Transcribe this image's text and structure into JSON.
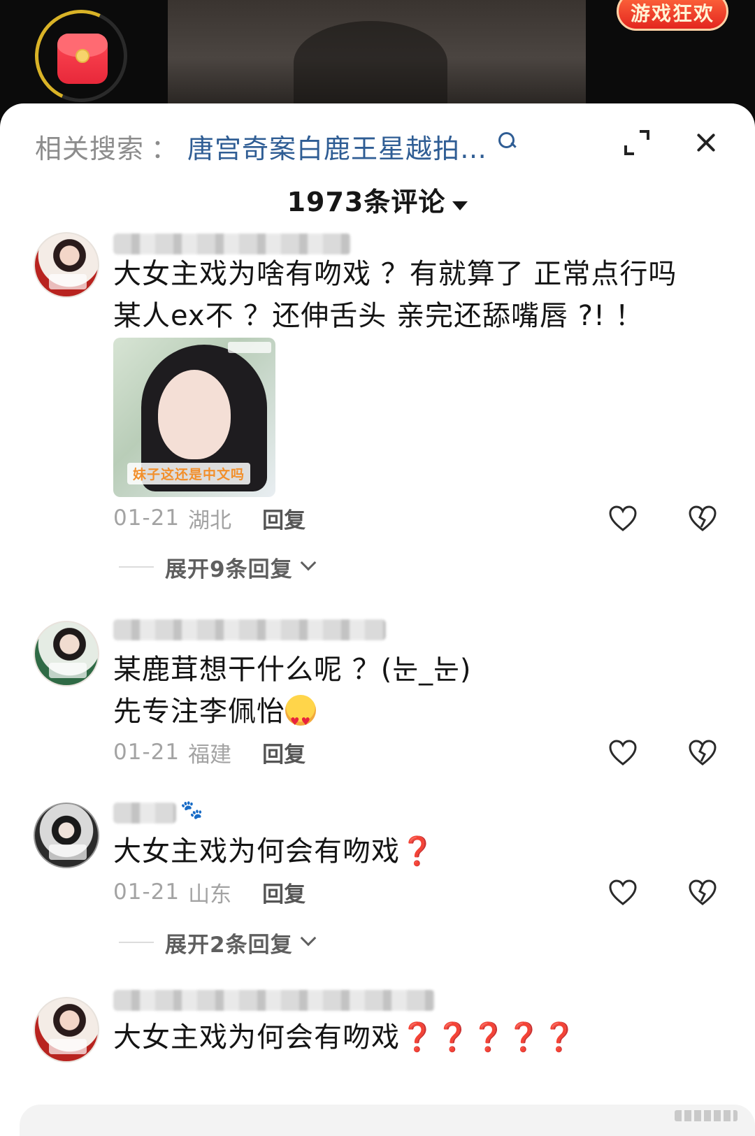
{
  "top": {
    "game_badge": "游戏狂欢",
    "red_packet_icon": "red-envelope-icon"
  },
  "header": {
    "search_label": "相关搜索",
    "search_colon": "：",
    "search_term": "唐宫奇案白鹿王星越拍…",
    "icons": [
      "search-icon",
      "expand-icon",
      "close-icon"
    ]
  },
  "comment_count": "1973条评论",
  "comments": [
    {
      "lines": [
        "大女主戏为啥有吻戏 ？有就算了 正常点行吗",
        "某人ex不 ？还伸舌头 亲完还舔嘴唇 ?! ！"
      ],
      "image_caption": "妹子这还是中文吗",
      "date": "01-21",
      "location": "湖北",
      "reply": "回复",
      "expand": "展开9条回复"
    },
    {
      "lines": [
        "某鹿茸想干什么呢 ？(눈_눈)",
        "先专注李佩怡"
      ],
      "date": "01-21",
      "location": "福建",
      "reply": "回复"
    },
    {
      "text": "大女主戏为何会有吻戏",
      "suffix": "❓",
      "date": "01-21",
      "location": "山东",
      "reply": "回复",
      "expand": "展开2条回复"
    },
    {
      "text": "大女主戏为何会有吻戏",
      "suffix": "❓❓❓❓❓"
    }
  ],
  "colors": {
    "link": "#2f5d94",
    "muted": "#a3a3a3",
    "question": "#e0292e",
    "badge": "#e3261f"
  }
}
